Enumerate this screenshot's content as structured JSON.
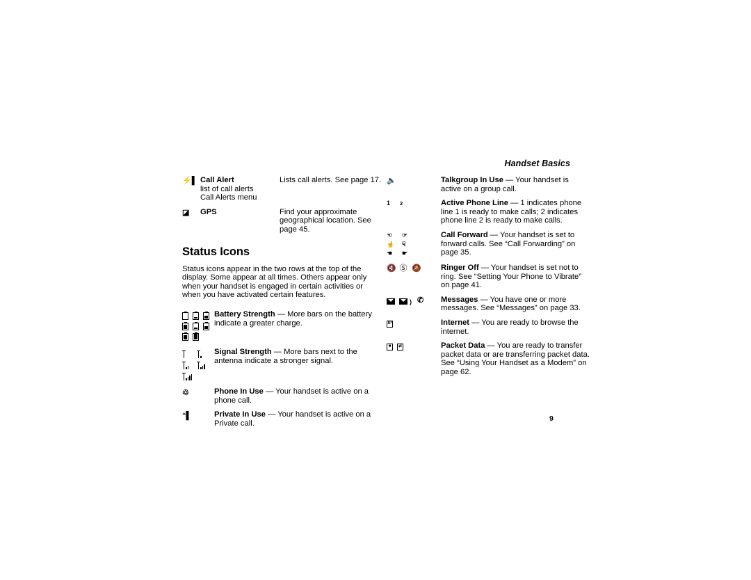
{
  "page": {
    "running_header": "Handset Basics",
    "folio": "9"
  },
  "left_column": {
    "feature_entries": [
      {
        "icon": "call-alert-icon",
        "term_name": "Call Alert",
        "term_extra_lines": [
          "list of call alerts",
          "Call Alerts menu"
        ],
        "description": "Lists call alerts. See page 17."
      },
      {
        "icon": "gps-icon",
        "term_name": "GPS",
        "term_extra_lines": [],
        "description": "Find your approximate geographical location. See page 45."
      }
    ],
    "section": {
      "heading": "Status Icons",
      "intro": "Status icons appear in the two rows at the top of the display. Some appear at all times. Others appear only when your handset is engaged in certain activities or when you have activated certain features."
    },
    "status_entries": [
      {
        "icons": "battery-strength-icons",
        "icon_count": 8,
        "label": "Battery Strength",
        "dash": "—",
        "text": "More bars on the battery indicate a greater charge."
      },
      {
        "icons": "signal-strength-icons",
        "icon_count": 5,
        "label": "Signal Strength",
        "dash": "—",
        "text": "More bars next to the antenna indicate a stronger signal."
      },
      {
        "icons": "phone-in-use-icon",
        "icon_count": 1,
        "label": "Phone In Use",
        "dash": "—",
        "text": "Your handset is active on a phone call."
      },
      {
        "icons": "private-in-use-icon",
        "icon_count": 1,
        "label": "Private In Use",
        "dash": "—",
        "text": "Your handset is active on a Private call."
      }
    ]
  },
  "right_column": {
    "status_entries": [
      {
        "icons": "talkgroup-in-use-icon",
        "label": "Talkgroup In Use",
        "dash": "—",
        "text": "Your handset is active on a group call."
      },
      {
        "icons": "active-phone-line-icons",
        "line_1": "1",
        "line_2": "2",
        "label": "Active Phone Line",
        "dash": "—",
        "text": "1 indicates phone line 1 is ready to make calls; 2 indicates phone line 2 is ready to make calls."
      },
      {
        "icons": "call-forward-icons",
        "label": "Call Forward",
        "dash": "—",
        "text": "Your handset is set to forward calls. See “Call Forwarding” on page 35."
      },
      {
        "icons": "ringer-off-icons",
        "label": "Ringer Off",
        "dash": "—",
        "text": "Your handset is set not to ring. See “Setting Your Phone to Vibrate” on page 41."
      },
      {
        "icons": "messages-icons",
        "label": "Messages",
        "dash": "—",
        "text": "You have one or more messages. See “Messages” on page 33."
      },
      {
        "icons": "internet-icon",
        "label": "Internet",
        "dash": "—",
        "text": "You are ready to browse the internet."
      },
      {
        "icons": "packet-data-icons",
        "label": "Packet Data",
        "dash": "—",
        "text": "You are ready to transfer packet data or are transferring packet data. See “Using Your Handset as a Modem” on page 62."
      }
    ]
  }
}
